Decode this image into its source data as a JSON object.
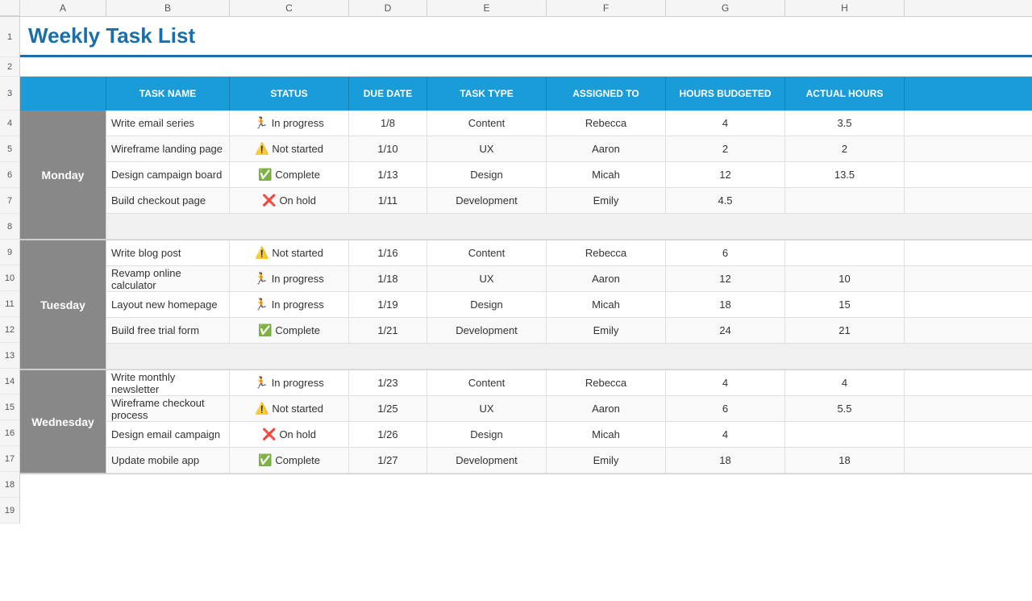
{
  "title": "Weekly Task List",
  "columns": {
    "letters": [
      "A",
      "B",
      "C",
      "D",
      "E",
      "F",
      "G",
      "H"
    ],
    "headers": [
      "TASK NAME",
      "STATUS",
      "DUE DATE",
      "TASK TYPE",
      "ASSIGNED TO",
      "HOURS BUDGETED",
      "ACTUAL HOURS"
    ]
  },
  "days": [
    {
      "name": "Monday",
      "tasks": [
        {
          "name": "Write email series",
          "status": "In progress",
          "status_icon": "🏃",
          "due": "1/8",
          "type": "Content",
          "assigned": "Rebecca",
          "budgeted": "4",
          "actual": "3.5"
        },
        {
          "name": "Wireframe landing page",
          "status": "Not started",
          "status_icon": "⚠️",
          "due": "1/10",
          "type": "UX",
          "assigned": "Aaron",
          "budgeted": "2",
          "actual": "2"
        },
        {
          "name": "Design campaign board",
          "status": "Complete",
          "status_icon": "✅",
          "due": "1/13",
          "type": "Design",
          "assigned": "Micah",
          "budgeted": "12",
          "actual": "13.5"
        },
        {
          "name": "Build checkout page",
          "status": "On hold",
          "status_icon": "❌",
          "due": "1/11",
          "type": "Development",
          "assigned": "Emily",
          "budgeted": "4.5",
          "actual": ""
        }
      ]
    },
    {
      "name": "Tuesday",
      "tasks": [
        {
          "name": "Write blog post",
          "status": "Not started",
          "status_icon": "⚠️",
          "due": "1/16",
          "type": "Content",
          "assigned": "Rebecca",
          "budgeted": "6",
          "actual": ""
        },
        {
          "name": "Revamp online calculator",
          "status": "In progress",
          "status_icon": "🏃",
          "due": "1/18",
          "type": "UX",
          "assigned": "Aaron",
          "budgeted": "12",
          "actual": "10"
        },
        {
          "name": "Layout new homepage",
          "status": "In progress",
          "status_icon": "🏃",
          "due": "1/19",
          "type": "Design",
          "assigned": "Micah",
          "budgeted": "18",
          "actual": "15"
        },
        {
          "name": "Build free trial form",
          "status": "Complete",
          "status_icon": "✅",
          "due": "1/21",
          "type": "Development",
          "assigned": "Emily",
          "budgeted": "24",
          "actual": "21"
        }
      ]
    },
    {
      "name": "Wednesday",
      "tasks": [
        {
          "name": "Write monthly newsletter",
          "status": "In progress",
          "status_icon": "🏃",
          "due": "1/23",
          "type": "Content",
          "assigned": "Rebecca",
          "budgeted": "4",
          "actual": "4"
        },
        {
          "name": "Wireframe checkout process",
          "status": "Not started",
          "status_icon": "⚠️",
          "due": "1/25",
          "type": "UX",
          "assigned": "Aaron",
          "budgeted": "6",
          "actual": "5.5"
        },
        {
          "name": "Design email campaign",
          "status": "On hold",
          "status_icon": "❌",
          "due": "1/26",
          "type": "Design",
          "assigned": "Micah",
          "budgeted": "4",
          "actual": ""
        },
        {
          "name": "Update mobile app",
          "status": "Complete",
          "status_icon": "✅",
          "due": "1/27",
          "type": "Development",
          "assigned": "Emily",
          "budgeted": "18",
          "actual": "18"
        }
      ]
    }
  ],
  "row_numbers": [
    "1",
    "2",
    "3",
    "4",
    "5",
    "6",
    "7",
    "8",
    "9",
    "10",
    "11",
    "12",
    "13",
    "14",
    "15",
    "16",
    "17",
    "18",
    "19"
  ]
}
